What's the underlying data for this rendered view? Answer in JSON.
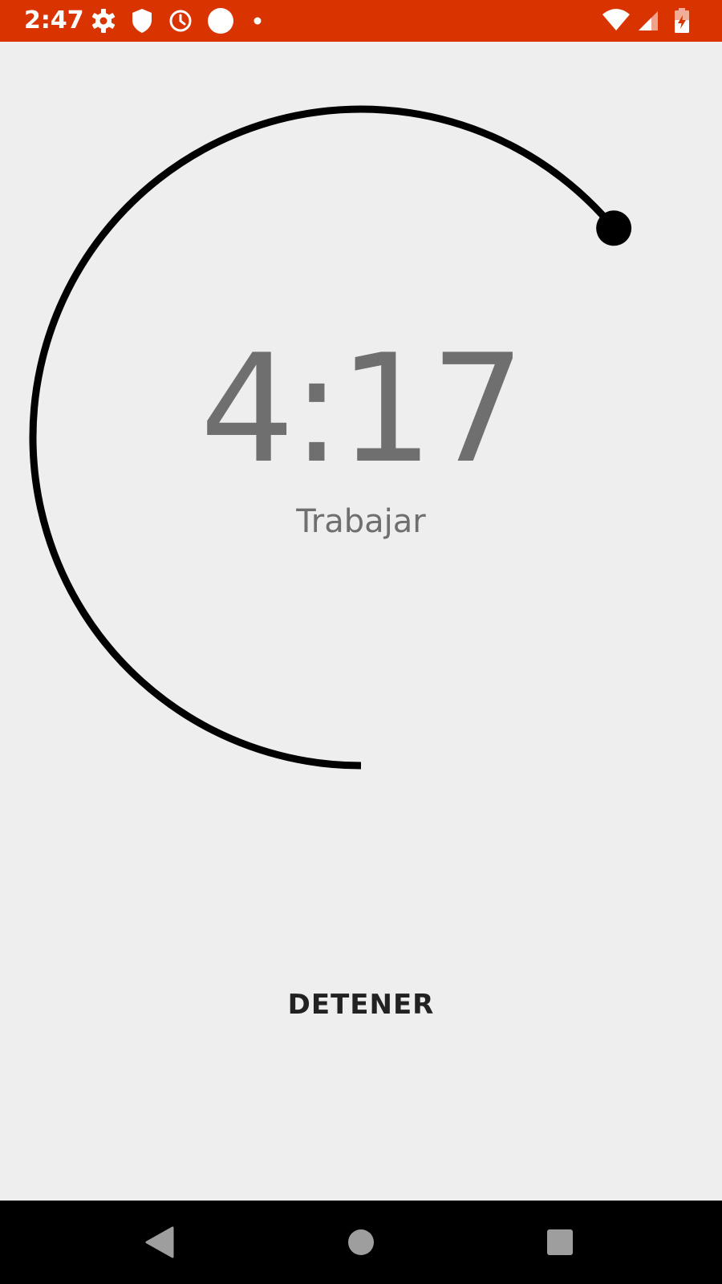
{
  "status_bar": {
    "time": "2:47",
    "background": "#d93400",
    "left_icons": [
      "settings-gear-icon",
      "shield-icon",
      "alarm-clock-icon",
      "circle-icon",
      "dot-icon"
    ],
    "right_icons": [
      "wifi-icon",
      "signal-icon",
      "battery-charging-icon"
    ]
  },
  "timer": {
    "time": "4:17",
    "label": "Trabajar",
    "progress_fraction": 0.64
  },
  "controls": {
    "stop_label": "DETENER"
  },
  "navigation": {
    "buttons": [
      "back-icon",
      "home-icon",
      "recents-icon"
    ]
  }
}
